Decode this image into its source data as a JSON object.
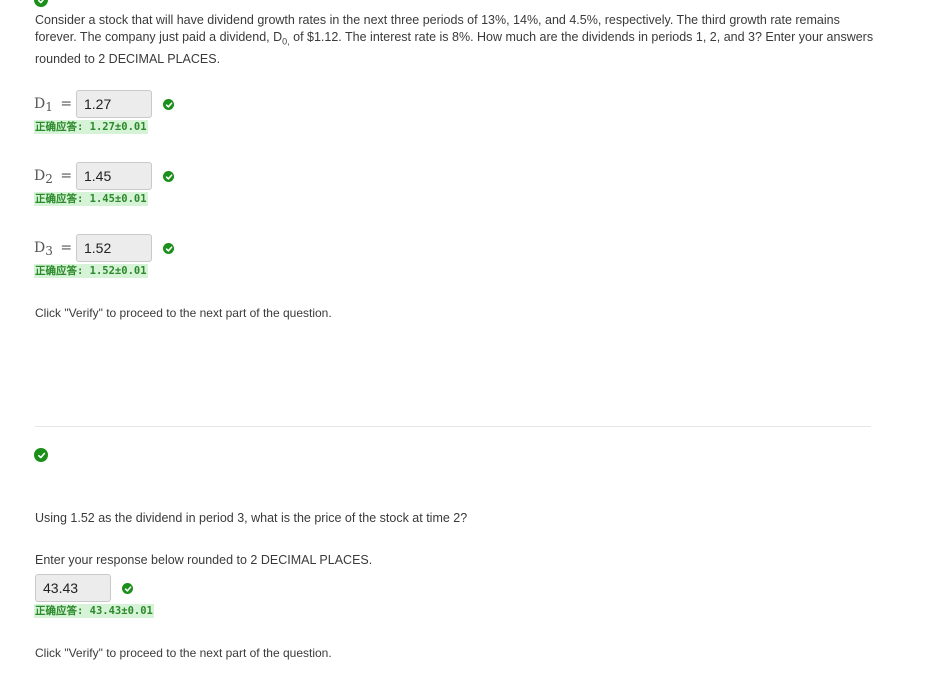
{
  "question1": {
    "text_before_sub": "Consider a stock that will have dividend growth rates in the next three periods of 13%, 14%, and 4.5%, respectively. The third growth rate remains forever. The company just paid a dividend, D",
    "text_sub": "0,",
    "text_after_sub": " of $1.12. The interest rate is 8%. How much are the dividends in periods 1, 2, and 3? Enter your answers rounded to 2 DECIMAL PLACES.",
    "answers": [
      {
        "var": "D",
        "sub": "1",
        "eq": "=",
        "value": "1.27",
        "correct_label": "正确应答: 1.27±0.01"
      },
      {
        "var": "D",
        "sub": "2",
        "eq": "=",
        "value": "1.45",
        "correct_label": "正确应答: 1.45±0.01"
      },
      {
        "var": "D",
        "sub": "3",
        "eq": "=",
        "value": "1.52",
        "correct_label": "正确应答: 1.52±0.01"
      }
    ],
    "verify_text": "Click \"Verify\" to proceed to the next part of the question."
  },
  "question2": {
    "text": "Using 1.52 as the dividend in period 3, what is the price of the stock at time 2?",
    "instruction": "Enter your response below rounded to 2 DECIMAL PLACES.",
    "value": "43.43",
    "correct_label": "正确应答: 43.43±0.01",
    "verify_text": "Click \"Verify\" to proceed to the next part of the question."
  },
  "icons": {
    "check": "check-circle-icon",
    "check_color": "#1a8f1a",
    "correct_bg": "#d7f3d7",
    "correct_fg": "#2a8a2a"
  }
}
